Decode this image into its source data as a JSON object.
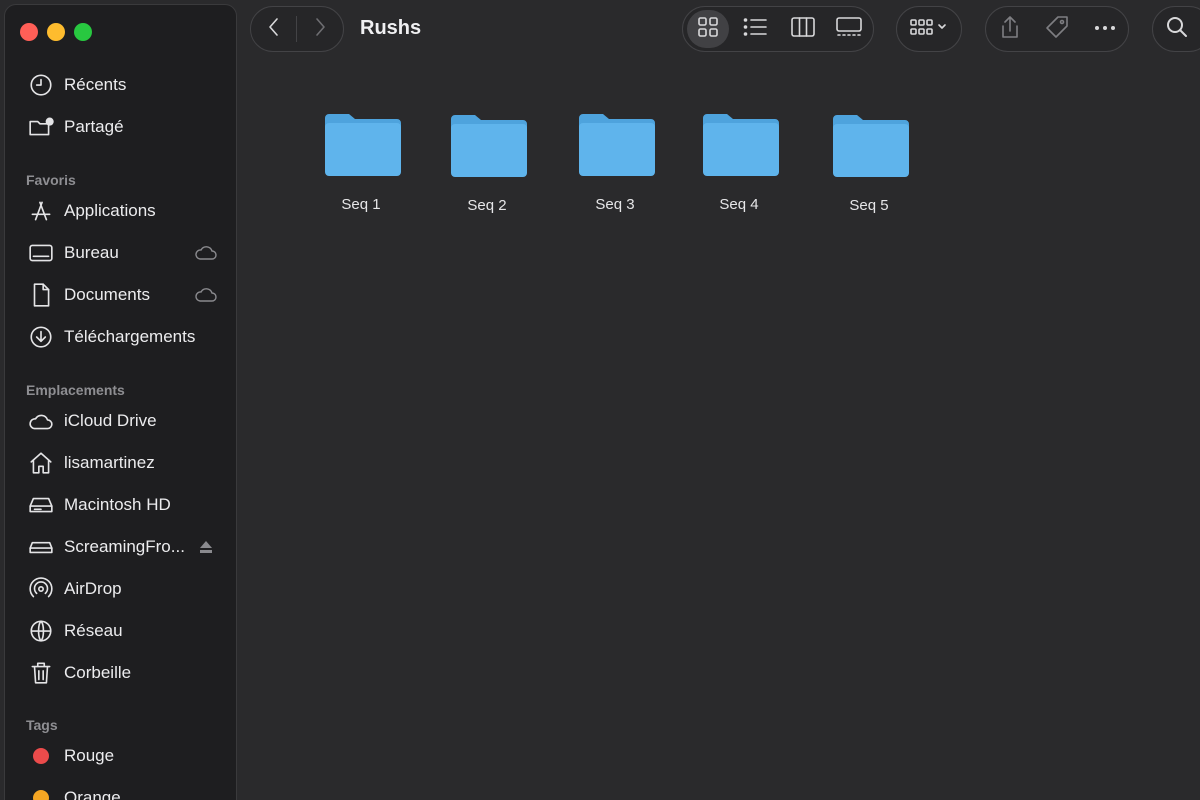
{
  "window": {
    "title": "Rushs"
  },
  "sidebar": {
    "top_items": [
      {
        "label": "Récents",
        "icon": "clock-icon"
      },
      {
        "label": "Partagé",
        "icon": "shared-folder-icon"
      }
    ],
    "sections": {
      "favorites": "Favoris",
      "locations": "Emplacements",
      "tags": "Tags"
    },
    "favorites": [
      {
        "label": "Applications",
        "icon": "applications-icon"
      },
      {
        "label": "Bureau",
        "icon": "desktop-icon",
        "accessory": "cloud-icon"
      },
      {
        "label": "Documents",
        "icon": "document-icon",
        "accessory": "cloud-icon"
      },
      {
        "label": "Téléchargements",
        "icon": "download-icon"
      }
    ],
    "locations": [
      {
        "label": "iCloud Drive",
        "icon": "cloud-icon"
      },
      {
        "label": "lisamartinez",
        "icon": "home-icon"
      },
      {
        "label": "Macintosh HD",
        "icon": "disk-icon"
      },
      {
        "label": "ScreamingFro...",
        "icon": "external-disk-icon",
        "accessory": "eject-icon"
      },
      {
        "label": "AirDrop",
        "icon": "airdrop-icon"
      },
      {
        "label": "Réseau",
        "icon": "globe-icon"
      },
      {
        "label": "Corbeille",
        "icon": "trash-icon"
      }
    ],
    "tags": [
      {
        "label": "Rouge",
        "color": "#eb4b4b"
      },
      {
        "label": "Orange",
        "color": "#f5a623"
      }
    ]
  },
  "content": {
    "folders": [
      {
        "name": "Seq 1"
      },
      {
        "name": "Seq 2"
      },
      {
        "name": "Seq 3"
      },
      {
        "name": "Seq 4"
      },
      {
        "name": "Seq 5"
      }
    ]
  },
  "colors": {
    "folder": "#5fb4ec",
    "close": "#ff5f57",
    "minimize": "#febc2e",
    "zoom": "#28c840"
  }
}
